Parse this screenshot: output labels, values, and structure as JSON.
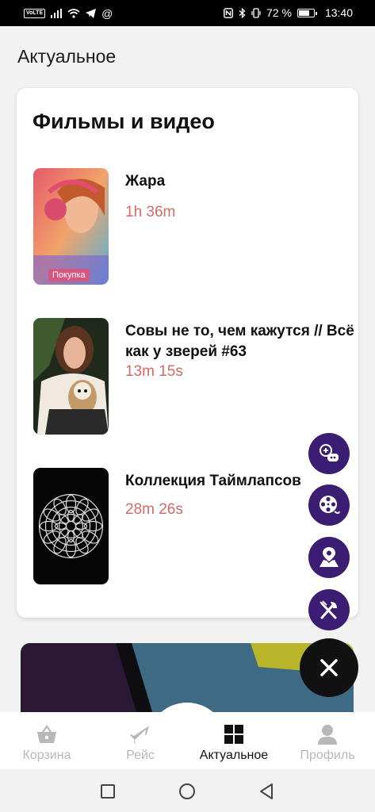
{
  "status_bar": {
    "volte": "VoLTE",
    "at": "@",
    "battery": "72 %",
    "time": "13:40"
  },
  "header": {
    "title": "Актуальное"
  },
  "movies_card": {
    "title": "Фильмы и видео",
    "items": [
      {
        "title": "Жара",
        "duration": "1h 36m",
        "badge": "Покупка"
      },
      {
        "title": "Совы не то, чем кажутся // Всё как у зверей #63",
        "duration": "13m 15s"
      },
      {
        "title": "Коллекция Таймлапсов",
        "duration": "28m 26s"
      }
    ]
  },
  "fab_menu": {
    "icons": [
      "games-icon",
      "film-reel-icon",
      "map-icon",
      "food-icon"
    ],
    "main_icon": "close-icon",
    "accent_color": "#3b1d74"
  },
  "bottom_nav": {
    "items": [
      {
        "label": "Корзина",
        "icon": "basket-icon"
      },
      {
        "label": "Рейс",
        "icon": "plane-icon"
      },
      {
        "label": "Актуальное",
        "icon": "grid-icon",
        "active": true
      },
      {
        "label": "Профиль",
        "icon": "person-icon"
      }
    ]
  },
  "system_nav": {
    "icons": [
      "recent-apps-icon",
      "home-icon",
      "back-icon"
    ]
  }
}
